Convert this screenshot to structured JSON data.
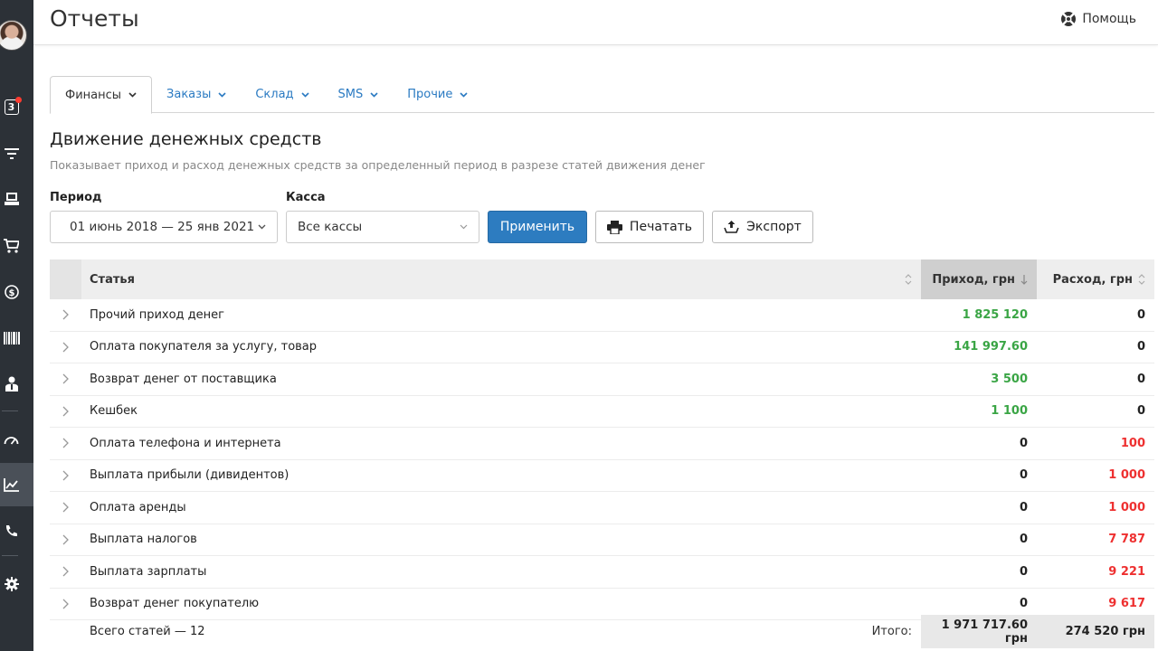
{
  "header": {
    "title": "Отчеты",
    "help_label": "Помощь"
  },
  "sidebar": {
    "notifications_count": "3"
  },
  "tabs": [
    {
      "label": "Финансы",
      "active": true
    },
    {
      "label": "Заказы",
      "active": false
    },
    {
      "label": "Склад",
      "active": false
    },
    {
      "label": "SMS",
      "active": false
    },
    {
      "label": "Прочие",
      "active": false
    }
  ],
  "section": {
    "title": "Движение денежных средств",
    "description": "Показывает приход и расход денежных средств за определенный период в разрезе статей движения денег"
  },
  "filters": {
    "period_label": "Период",
    "period_value": "01 июнь 2018 — 25 янв 2021",
    "cash_label": "Касса",
    "cash_value": "Все кассы",
    "apply_label": "Применить",
    "print_label": "Печатать",
    "export_label": "Экспорт"
  },
  "table": {
    "headers": {
      "article": "Статья",
      "income": "Приход, грн",
      "expense": "Расход, грн"
    },
    "rows": [
      {
        "name": "Прочий приход денег",
        "income": "1 825 120",
        "expense": "0"
      },
      {
        "name": "Оплата покупателя за услугу, товар",
        "income": "141 997.60",
        "expense": "0"
      },
      {
        "name": "Возврат денег от поставщика",
        "income": "3 500",
        "expense": "0"
      },
      {
        "name": "Кешбек",
        "income": "1 100",
        "expense": "0"
      },
      {
        "name": "Оплата телефона и интернета",
        "income": "0",
        "expense": "100"
      },
      {
        "name": "Выплата прибыли (дивидентов)",
        "income": "0",
        "expense": "1 000"
      },
      {
        "name": "Оплата аренды",
        "income": "0",
        "expense": "1 000"
      },
      {
        "name": "Выплата налогов",
        "income": "0",
        "expense": "7 787"
      },
      {
        "name": "Выплата зарплаты",
        "income": "0",
        "expense": "9 221"
      },
      {
        "name": "Возврат денег покупателю",
        "income": "0",
        "expense": "9 617"
      }
    ]
  },
  "footer": {
    "total_articles": "Всего статей — 12",
    "sum_label": "Итого:",
    "income_total": "1 971 717.60 грн",
    "expense_total": "274 520 грн"
  },
  "colors": {
    "accent": "#2d7cc0",
    "income": "#3aa545",
    "expense": "#ee3030",
    "sidebar": "#2c3137"
  }
}
